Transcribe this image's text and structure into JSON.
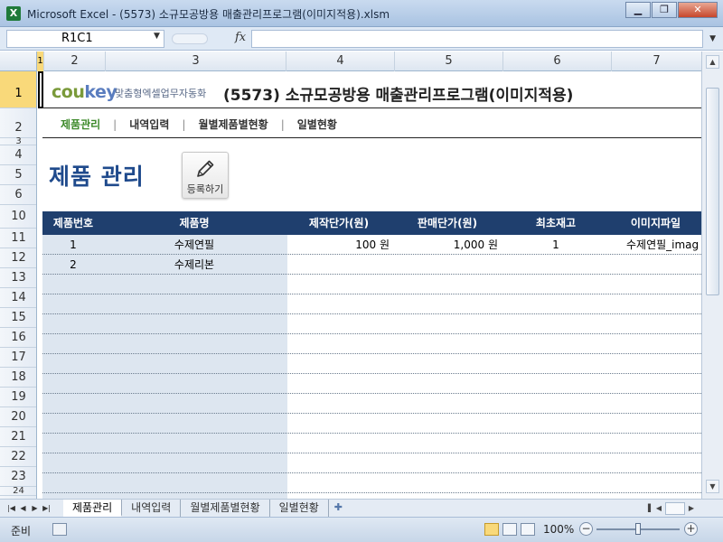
{
  "window": {
    "app_icon": "X",
    "title": "Microsoft Excel - (5573) 소규모공방용 매출관리프로그램(이미지적용).xlsm",
    "buttons": [
      "minimize-icon",
      "restore-icon",
      "close-icon"
    ]
  },
  "formula_bar": {
    "name_box": "R1C1",
    "fx": "fx",
    "formula": ""
  },
  "columns": [
    {
      "label": "1",
      "selected": true
    },
    {
      "label": "2"
    },
    {
      "label": "3"
    },
    {
      "label": "4"
    },
    {
      "label": "5"
    },
    {
      "label": "6"
    },
    {
      "label": "7"
    }
  ],
  "rows": [
    "1",
    "2",
    "3",
    "4",
    "5",
    "6",
    "10",
    "11",
    "12",
    "13",
    "14",
    "15",
    "16",
    "17",
    "18",
    "19",
    "20",
    "21",
    "22",
    "23",
    "24"
  ],
  "header": {
    "logo_main": "cou",
    "logo_accent": "key",
    "logo_sub": "맞춤형엑셀업무자동화",
    "title": "(5573) 소규모공방용 매출관리프로그램(이미지적용)"
  },
  "nav": {
    "items": [
      "제품관리",
      "내역입력",
      "월별제품별현황",
      "일별현황"
    ],
    "active": 0,
    "separator": "|"
  },
  "page": {
    "title": "제품 관리",
    "register_button": "등록하기"
  },
  "table": {
    "headers": [
      "제품번호",
      "제품명",
      "제작단가(원)",
      "판매단가(원)",
      "최초재고",
      "이미지파일"
    ],
    "rows": [
      [
        "1",
        "수제연필",
        "100 원",
        "1,000 원",
        "1",
        "수제연필_imag"
      ],
      [
        "2",
        "수제리본",
        "",
        "",
        "",
        ""
      ]
    ],
    "empty_rows": 11
  },
  "sheet_tabs": {
    "tabs": [
      "제품관리",
      "내역입력",
      "월별제품별현황",
      "일별현황"
    ],
    "active": 0
  },
  "status": {
    "ready": "준비",
    "zoom": "100%",
    "zoom_level_pct": 100
  }
}
